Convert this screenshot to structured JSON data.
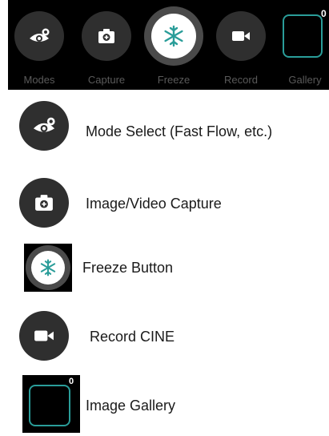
{
  "toolbar": {
    "modes_label": "Modes",
    "capture_label": "Capture",
    "freeze_label": "Freeze",
    "record_label": "Record",
    "gallery_label": "Gallery",
    "gallery_count": "0"
  },
  "legend": {
    "modes": "Mode Select (Fast Flow, etc.)",
    "capture": "Image/Video Capture",
    "freeze": "Freeze Button",
    "record": "Record CINE",
    "gallery": "Image Gallery"
  },
  "colors": {
    "toolbar_bg": "#000000",
    "button_bg": "#2f2f2f",
    "accent_teal": "#2a9d99",
    "label_gray": "#5a5a5a"
  },
  "icons": {
    "modes": "eye-gear-icon",
    "capture": "camera-icon",
    "freeze": "snowflake-icon",
    "record": "video-camera-icon",
    "gallery": "gallery-frame-icon"
  }
}
